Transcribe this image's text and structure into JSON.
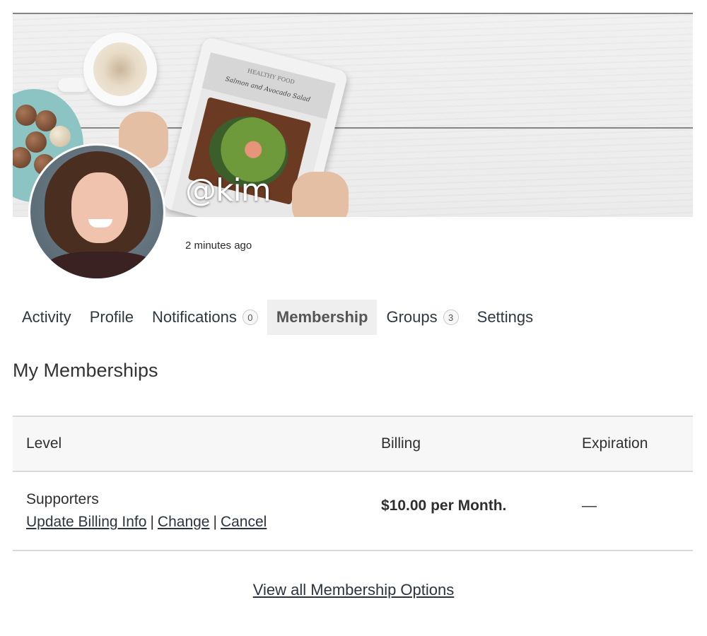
{
  "profile": {
    "handle": "@kim",
    "last_active": "2 minutes ago",
    "cover_text": {
      "tablet_title": "HEALTHY FOOD",
      "tablet_subtitle": "Salmon and Avocado Salad"
    }
  },
  "tabs": [
    {
      "label": "Activity",
      "active": false
    },
    {
      "label": "Profile",
      "active": false
    },
    {
      "label": "Notifications",
      "badge": "0",
      "active": false
    },
    {
      "label": "Membership",
      "active": true
    },
    {
      "label": "Groups",
      "badge": "3",
      "active": false
    },
    {
      "label": "Settings",
      "active": false
    }
  ],
  "memberships": {
    "title": "My Memberships",
    "columns": [
      "Level",
      "Billing",
      "Expiration"
    ],
    "rows": [
      {
        "level": "Supporters",
        "actions": [
          "Update Billing Info",
          "Change",
          "Cancel"
        ],
        "separator": "|",
        "billing": "$10.00 per Month.",
        "expiration": "—"
      }
    ],
    "view_all_label": "View all Membership Options"
  }
}
